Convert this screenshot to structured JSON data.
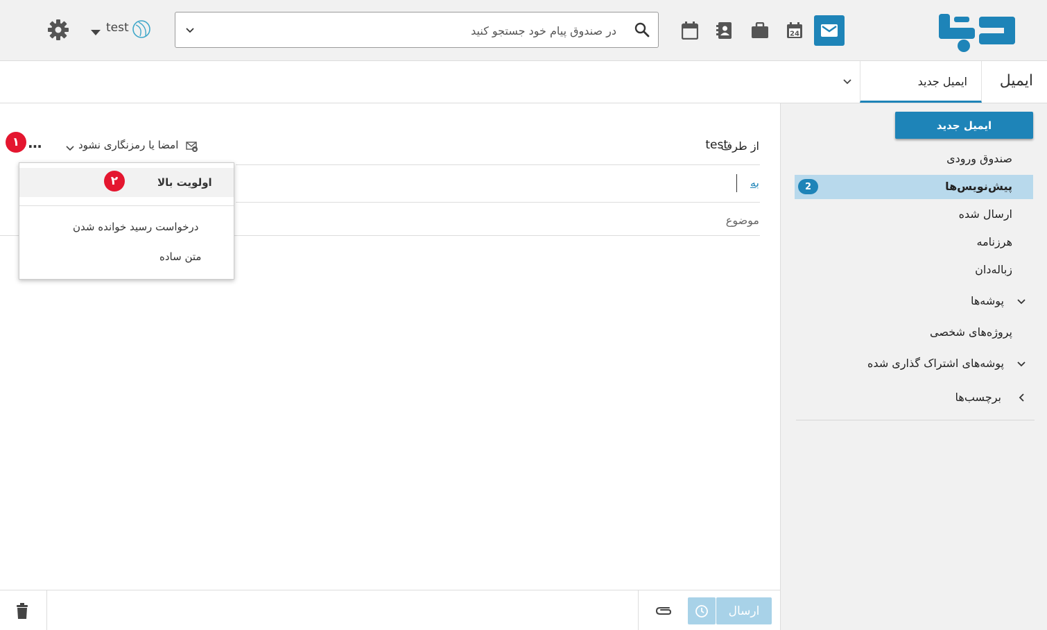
{
  "header": {
    "logo_text": "توکا",
    "calendar_day": "24",
    "search_placeholder": "در صندوق پیام خود جستجو کنید",
    "account_name": "test"
  },
  "tabs": {
    "app_title": "ایمیل",
    "new_email_tab": "ایمیل جدید"
  },
  "sidebar": {
    "new_email_button": "ایمیل جدید",
    "inbox": "صندوق ورودی",
    "drafts": "پیش‌نویس‌ها",
    "drafts_count": "2",
    "sent": "ارسال شده",
    "spam": "هرزنامه",
    "trash": "زباله‌دان",
    "folders": "پوشه‌ها",
    "personal_projects": "پروژه‌های شخصی",
    "shared_folders": "پوشه‌های اشتراک گذاری شده",
    "labels": "برچسب‌ها"
  },
  "compose": {
    "from_label": "از طرف",
    "from_value": "test",
    "to_label": "به",
    "subject_placeholder": "موضوع",
    "security_option": "امضا یا رمزنگاری نشود",
    "more_dots": "..."
  },
  "menu": {
    "high_priority": "اولویت بالا",
    "read_receipt": "درخواست رسید خوانده شدن",
    "plain_text": "متن ساده"
  },
  "annotations": {
    "badge_1": "۱",
    "badge_2": "۲"
  },
  "footer": {
    "send_button": "ارسال"
  },
  "colors": {
    "accent": "#1e84b8",
    "drafts_highlight": "#b8d9ec",
    "annotation_red": "#e4162f"
  }
}
